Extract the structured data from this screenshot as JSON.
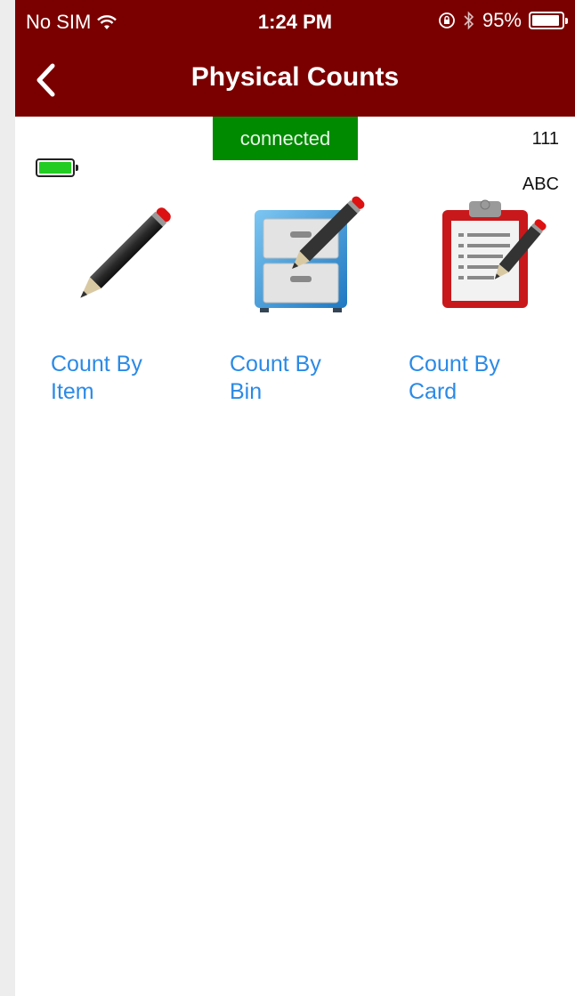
{
  "status_bar": {
    "carrier": "No SIM",
    "time": "1:24 PM",
    "battery_percent": "95%",
    "battery_level": 0.95,
    "icons": [
      "wifi-icon",
      "orientation-lock-icon",
      "bluetooth-icon",
      "battery-icon"
    ]
  },
  "nav": {
    "title": "Physical Counts",
    "back_icon": "chevron-left-icon",
    "bar_color": "#7a0000"
  },
  "connection": {
    "status": "connected",
    "color": "#008a00"
  },
  "counter": "111",
  "mode_label": "ABC",
  "device_battery": {
    "level": 1.0,
    "color": "#22cc22"
  },
  "options": [
    {
      "label": "Count By Item",
      "icon": "pencil-icon"
    },
    {
      "label": "Count By Bin",
      "icon": "file-cabinet-edit-icon"
    },
    {
      "label": "Count By Card",
      "icon": "clipboard-edit-icon"
    }
  ],
  "colors": {
    "link": "#2b8ae6"
  }
}
